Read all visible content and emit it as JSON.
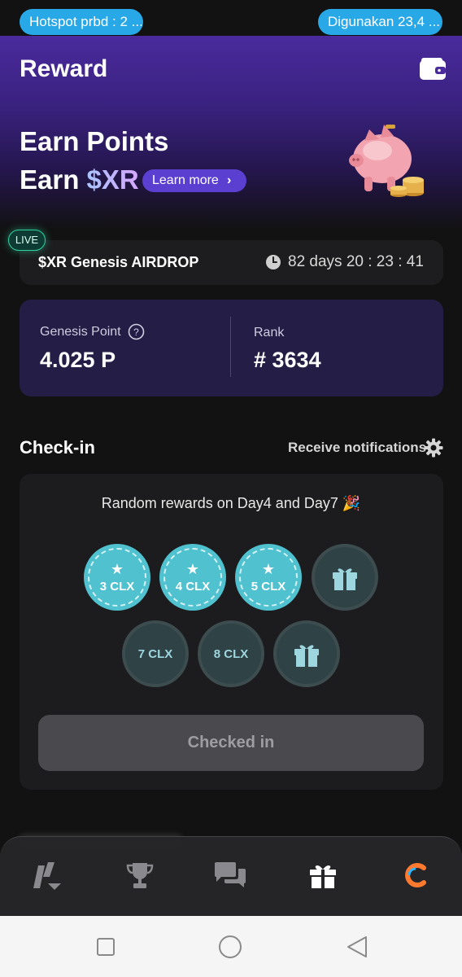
{
  "status_bar": {
    "hotspot_text": "Hotspot prbd : 2 ...",
    "usage_text": "Digunakan 23,4 ..."
  },
  "header": {
    "title": "Reward",
    "wallet_icon": "wallet-icon"
  },
  "hero": {
    "line1": "Earn Points",
    "line2_prefix": "Earn ",
    "line2_token": "$XR",
    "learn_more_label": "Learn more",
    "illustration": "piggy-bank-icon"
  },
  "airdrop": {
    "live_badge": "LIVE",
    "title": "$XR Genesis AIRDROP",
    "countdown": "82 days  20 : 23 : 41"
  },
  "stats": {
    "genesis_point_label": "Genesis Point",
    "genesis_point_value": "4.025 P",
    "rank_label": "Rank",
    "rank_value": "# 3634"
  },
  "checkin": {
    "title": "Check-in",
    "notifications_label": "Receive notifications",
    "random_rewards_text": "Random rewards on Day4 and Day7 🎉",
    "days": [
      {
        "label": "3 CLX",
        "state": "claimed"
      },
      {
        "label": "4 CLX",
        "state": "claimed"
      },
      {
        "label": "5 CLX",
        "state": "claimed"
      },
      {
        "label": "",
        "state": "gift"
      },
      {
        "label": "7 CLX",
        "state": "future"
      },
      {
        "label": "8 CLX",
        "state": "future"
      },
      {
        "label": "",
        "state": "gift"
      }
    ],
    "button_label": "Checked in"
  },
  "tabbar": {
    "items": [
      "logo-icon",
      "trophy-icon",
      "chat-icon",
      "gift-icon",
      "c-logo-icon"
    ],
    "active": "gift-icon"
  },
  "colors": {
    "accent_purple": "#5b3fd0",
    "claimed_teal": "#4fc1cf",
    "live_green": "#2fd1a0",
    "hotspot_blue": "#29a8e8"
  }
}
